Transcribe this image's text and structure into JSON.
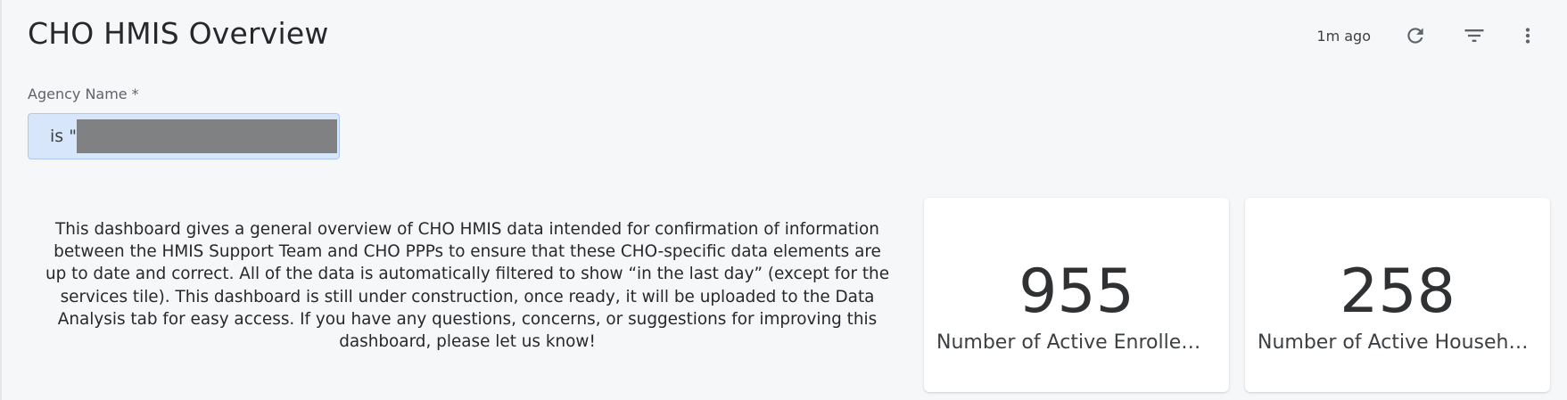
{
  "header": {
    "title": "CHO HMIS Overview",
    "updated": "1m ago",
    "icons": {
      "refresh": "refresh-icon",
      "filter": "filter-icon",
      "more": "more-vert-icon"
    }
  },
  "filter": {
    "label": "Agency Name",
    "required_mark": "*",
    "chip_text": "is \""
  },
  "description": "This dashboard gives a general overview of CHO HMIS data intended for confirmation of information between the HMIS Support Team and CHO PPPs to ensure that these CHO-specific data elements are up to date and correct.  All of the data is automatically filtered to show “in the last day” (except for the services tile). This dashboard is still under construction, once ready, it will be uploaded to the Data Analysis tab for easy access.  If you have any questions, concerns, or suggestions for improving this dashboard, please let us know!",
  "tiles": [
    {
      "value": "955",
      "label": "Number of Active Enrollem…"
    },
    {
      "value": "258",
      "label": "Number of Active Househo…"
    }
  ],
  "colors": {
    "background": "#f6f7f9",
    "chip_background": "#d8e6fb",
    "chip_border": "#aec8ef",
    "icon": "#5f6368",
    "tile": "#ffffff"
  }
}
